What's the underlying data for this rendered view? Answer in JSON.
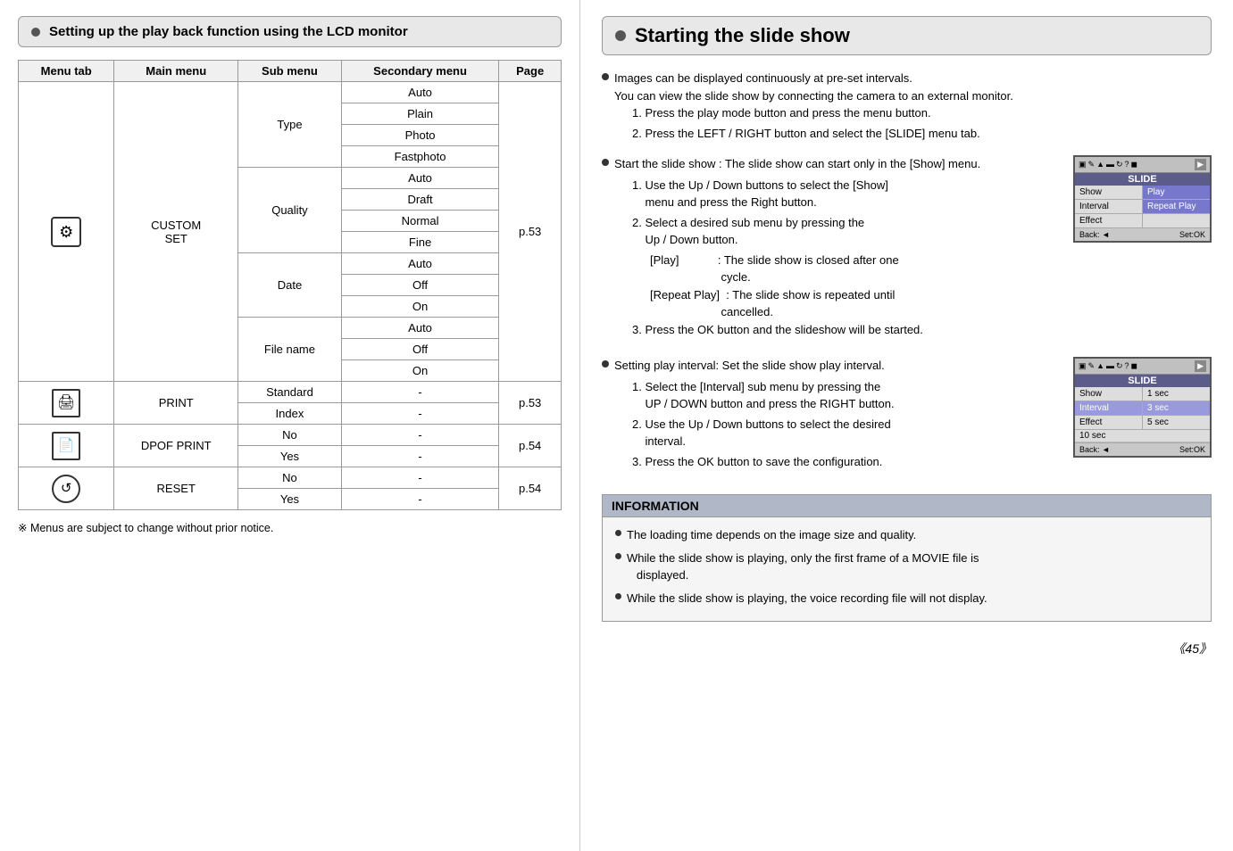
{
  "left": {
    "header": "Setting up the play back function using the LCD monitor",
    "table": {
      "columns": [
        "Menu tab",
        "Main menu",
        "Sub menu",
        "Secondary menu",
        "Page"
      ],
      "rows": [
        {
          "menu_tab_icon": "custom",
          "main_menu": "CUSTOM SET",
          "sub_menus": [
            {
              "sub": "Type",
              "items": [
                "Auto",
                "Plain",
                "Photo",
                "Fastphoto"
              ],
              "page": "p.53"
            },
            {
              "sub": "Quality",
              "items": [
                "Auto",
                "Draft",
                "Normal",
                "Fine"
              ],
              "page": "p.53"
            },
            {
              "sub": "Date",
              "items": [
                "Auto",
                "Off",
                "On"
              ],
              "page": "p.53"
            },
            {
              "sub": "File name",
              "items": [
                "Auto",
                "Off",
                "On"
              ],
              "page": "p.53"
            }
          ]
        },
        {
          "menu_tab_icon": "print",
          "main_menu": "PRINT",
          "sub_menus": [
            {
              "sub": "Standard",
              "items": [
                "-"
              ],
              "page": "p.53"
            },
            {
              "sub": "Index",
              "items": [
                "-"
              ],
              "page": "p.53"
            }
          ]
        },
        {
          "menu_tab_icon": "dpof",
          "main_menu": "DPOF PRINT",
          "sub_menus": [
            {
              "sub": "",
              "items": [
                "No",
                "-",
                "Yes",
                "-"
              ],
              "page": "p.54"
            }
          ]
        },
        {
          "menu_tab_icon": "reset",
          "main_menu": "RESET",
          "sub_menus": [
            {
              "sub": "",
              "items": [
                "No",
                "-",
                "Yes",
                "-"
              ],
              "page": "p.54"
            }
          ]
        }
      ]
    },
    "footnote": "※  Menus are subject to change without prior notice."
  },
  "right": {
    "header": "Starting the slide show",
    "intro_bullets": [
      "Images can be displayed continuously at pre-set intervals.",
      "You can view the slide show by connecting the camera to an external monitor.",
      "1. Press the play mode button and press the menu button.",
      "2. Press the LEFT / RIGHT button and select the [SLIDE] menu tab."
    ],
    "section1": {
      "title": "Start the slide show : The slide show can start only in the [Show] menu.",
      "steps": [
        "1. Use the Up / Down buttons to select the [Show] menu and press the Right button.",
        "2. Select a desired sub menu by pressing the Up / Down button.",
        "[Play]           : The slide show is closed after one cycle.",
        "[Repeat Play]  : The slide show is repeated until cancelled.",
        "3. Press the OK button and the slideshow will be started."
      ],
      "lcd1": {
        "icons": [
          "▣",
          "✏",
          "▲",
          "▬",
          "↻",
          "?",
          "◼"
        ],
        "title": "SLIDE",
        "rows": [
          {
            "label": "Show",
            "value": "Play",
            "selected": true
          },
          {
            "label": "Interval",
            "value": "Repeat Play",
            "selected": false
          },
          {
            "label": "Effect",
            "value": "",
            "selected": false
          }
        ],
        "footer_left": "Back: ◄",
        "footer_right": "Set:OK"
      }
    },
    "section2": {
      "title": "Setting play interval: Set the slide show play interval.",
      "steps": [
        "1. Select the [Interval] sub menu by pressing the UP / DOWN button and press the RIGHT button.",
        "2. Use the Up / Down buttons to select the desired interval.",
        "3. Press the OK button to save the configuration."
      ],
      "lcd2": {
        "icons": [
          "▣",
          "✏",
          "▲",
          "▬",
          "↻",
          "?",
          "◼"
        ],
        "title": "SLIDE",
        "rows": [
          {
            "label": "Show",
            "value": ""
          },
          {
            "label": "Interval",
            "value": "3 sec",
            "selected": true
          },
          {
            "label": "Effect",
            "value": ""
          }
        ],
        "subitems": [
          "1 sec",
          "3 sec",
          "5 sec",
          "10 sec"
        ],
        "selected_subitem": "3 sec",
        "footer_left": "Back: ◄",
        "footer_right": "Set:OK"
      }
    },
    "info": {
      "title": "INFORMATION",
      "items": [
        "The loading time depends on the image size and quality.",
        "While the slide show is playing, only the first frame of a MOVIE file is displayed.",
        "While the slide show is playing, the voice recording file will not display."
      ]
    },
    "page_number": "《45》"
  }
}
